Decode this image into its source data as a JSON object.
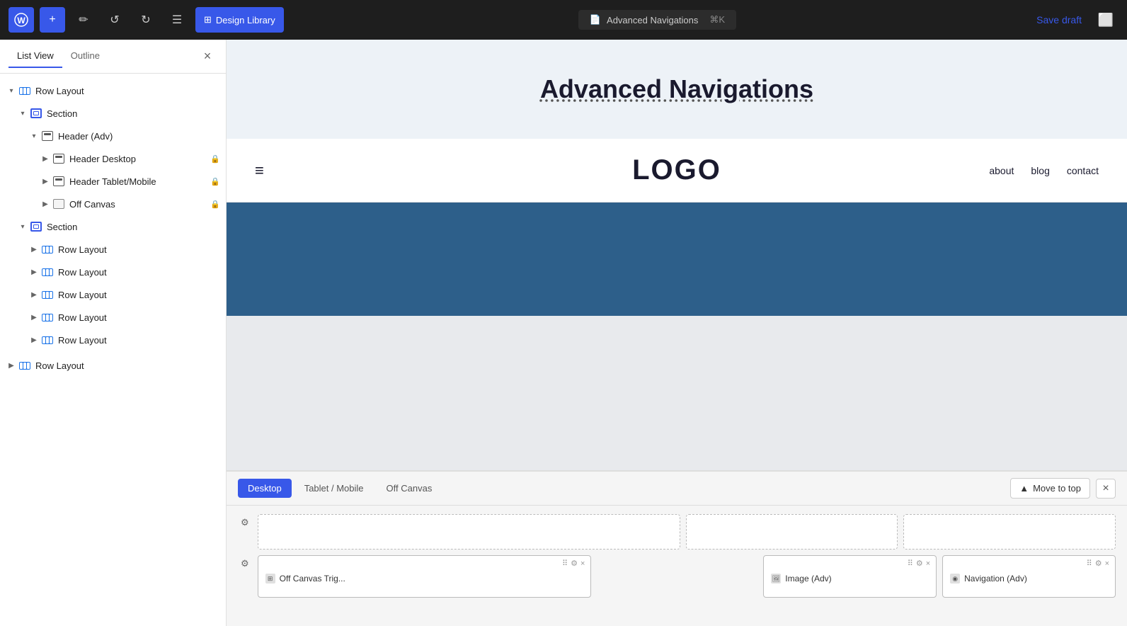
{
  "toolbar": {
    "wp_logo": "W",
    "add_label": "+",
    "tools_label": "✎",
    "undo_label": "↺",
    "redo_label": "↻",
    "list_view_label": "☰",
    "design_library_label": "Design Library",
    "page_name": "Advanced Navigations",
    "shortcut": "⌘K",
    "save_draft_label": "Save draft",
    "preview_label": "□"
  },
  "sidebar": {
    "tab_list_view": "List View",
    "tab_outline": "Outline",
    "close_label": "×",
    "tree": [
      {
        "id": "row-layout-1",
        "label": "Row Layout",
        "level": 0,
        "expanded": true,
        "icon": "row",
        "has_arrow": true
      },
      {
        "id": "section-1",
        "label": "Section",
        "level": 1,
        "expanded": true,
        "icon": "section",
        "has_arrow": true
      },
      {
        "id": "header-adv",
        "label": "Header (Adv)",
        "level": 2,
        "expanded": true,
        "icon": "header",
        "has_arrow": true
      },
      {
        "id": "header-desktop",
        "label": "Header Desktop",
        "level": 3,
        "expanded": false,
        "icon": "header-sm",
        "has_arrow": true,
        "locked": true
      },
      {
        "id": "header-tablet",
        "label": "Header Tablet/Mobile",
        "level": 3,
        "expanded": false,
        "icon": "header-sm",
        "has_arrow": true,
        "locked": true
      },
      {
        "id": "off-canvas",
        "label": "Off Canvas",
        "level": 3,
        "expanded": false,
        "icon": "off-canvas",
        "has_arrow": true,
        "locked": true
      },
      {
        "id": "section-2",
        "label": "Section",
        "level": 1,
        "expanded": true,
        "icon": "section",
        "has_arrow": true
      },
      {
        "id": "row-layout-2",
        "label": "Row Layout",
        "level": 2,
        "expanded": false,
        "icon": "row",
        "has_arrow": true
      },
      {
        "id": "row-layout-3",
        "label": "Row Layout",
        "level": 2,
        "expanded": false,
        "icon": "row",
        "has_arrow": true
      },
      {
        "id": "row-layout-4",
        "label": "Row Layout",
        "level": 2,
        "expanded": false,
        "icon": "row",
        "has_arrow": true
      },
      {
        "id": "row-layout-5",
        "label": "Row Layout",
        "level": 2,
        "expanded": false,
        "icon": "row",
        "has_arrow": true
      },
      {
        "id": "row-layout-6",
        "label": "Row Layout",
        "level": 2,
        "expanded": false,
        "icon": "row",
        "has_arrow": true
      },
      {
        "id": "row-layout-7",
        "label": "Row Layout",
        "level": 0,
        "expanded": false,
        "icon": "row",
        "has_arrow": true
      }
    ]
  },
  "canvas": {
    "page_title": "Advanced Navigations",
    "nav_hamburger": "≡",
    "nav_logo": "LOGO",
    "nav_links": [
      "about",
      "blog",
      "contact"
    ]
  },
  "bottom_panel": {
    "tabs": [
      "Desktop",
      "Tablet / Mobile",
      "Off Canvas"
    ],
    "active_tab": "Desktop",
    "move_to_top_label": "Move to top",
    "close_label": "×",
    "widgets": [
      {
        "label": "Off Canvas Trig...",
        "type": "off-canvas-trigger",
        "icons": "⊞"
      },
      {
        "label": "Image (Adv)",
        "type": "image",
        "icons": "🖼"
      },
      {
        "label": "Navigation (Adv)",
        "type": "navigation",
        "icons": "◉"
      }
    ]
  }
}
